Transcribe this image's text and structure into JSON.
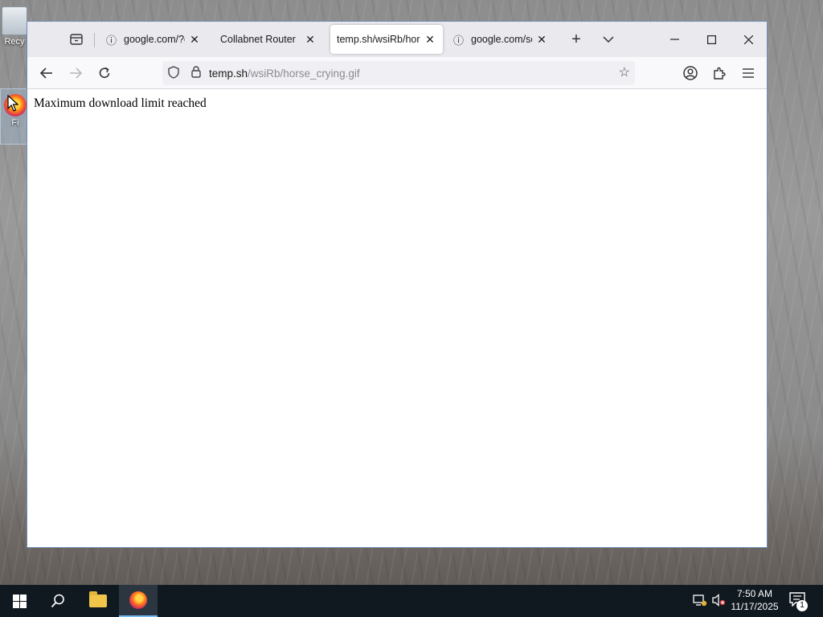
{
  "desktop": {
    "icons": [
      {
        "label": "Recy"
      },
      {
        "label": "Fi"
      }
    ]
  },
  "browser": {
    "tabs": [
      {
        "title": "google.com/?gws_rd=ssl",
        "icon": "info-icon",
        "active": false
      },
      {
        "title": "Collabnet Router",
        "icon": "",
        "active": false
      },
      {
        "title": "temp.sh/wsiRb/horse_crying.gif",
        "icon": "",
        "active": true
      },
      {
        "title": "google.com/search",
        "icon": "info-icon",
        "active": false
      }
    ],
    "url": {
      "host": "temp.sh",
      "path": "/wsiRb/horse_crying.gif"
    },
    "page": {
      "message": "Maximum download limit reached"
    }
  },
  "taskbar": {
    "time": "7:50 AM",
    "date": "11/17/2025",
    "notifications": "1"
  },
  "colors": {
    "tabbar": "#e9e9ee",
    "navbar": "#f9f9fb",
    "taskbar": "#101820",
    "window_border": "#6d8fb6"
  }
}
